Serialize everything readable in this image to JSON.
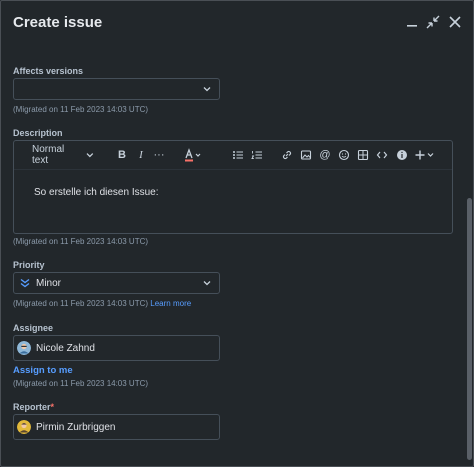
{
  "header": {
    "title": "Create issue"
  },
  "fields": {
    "affects_versions": {
      "label": "Affects versions",
      "value": "",
      "hint": "(Migrated on 11 Feb 2023 14:03 UTC)"
    },
    "description": {
      "label": "Description",
      "text_style": "Normal text",
      "body": "So erstelle ich diesen Issue:",
      "hint": "(Migrated on 11 Feb 2023 14:03 UTC)"
    },
    "priority": {
      "label": "Priority",
      "value": "Minor",
      "hint": "(Migrated on 11 Feb 2023 14:03 UTC)",
      "hint_link": "Learn more"
    },
    "assignee": {
      "label": "Assignee",
      "value": "Nicole Zahnd",
      "assign_to_me": "Assign to me",
      "hint": "(Migrated on 11 Feb 2023 14:03 UTC)"
    },
    "reporter": {
      "label": "Reporter",
      "required_mark": "*",
      "value": "Pirmin Zurbriggen"
    }
  },
  "colors": {
    "accent": "#579dff",
    "priority_minor": "#579dff",
    "required": "#f87168"
  }
}
